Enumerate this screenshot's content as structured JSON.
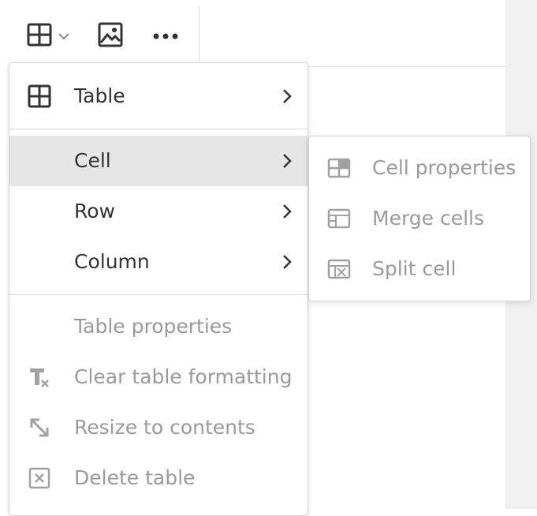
{
  "toolbar": {
    "table_icon": "table-icon",
    "table_dropdown_icon": "chevron-down-icon",
    "image_icon": "image-icon",
    "more_icon": "more-dots-icon"
  },
  "main_menu": {
    "table": {
      "label": "Table",
      "icon": "table-icon"
    },
    "cell": {
      "label": "Cell"
    },
    "row": {
      "label": "Row"
    },
    "column": {
      "label": "Column"
    },
    "table_properties": {
      "label": "Table properties"
    },
    "clear_formatting": {
      "label": "Clear table formatting",
      "icon": "clear-format-icon"
    },
    "resize": {
      "label": "Resize to contents",
      "icon": "resize-icon"
    },
    "delete": {
      "label": "Delete table",
      "icon": "delete-table-icon"
    }
  },
  "cell_submenu": {
    "cell_properties": {
      "label": "Cell properties",
      "icon": "cell-properties-icon"
    },
    "merge_cells": {
      "label": "Merge cells",
      "icon": "merge-cells-icon"
    },
    "split_cell": {
      "label": "Split cell",
      "icon": "split-cell-icon"
    }
  },
  "colors": {
    "text": "#333333",
    "disabled_text": "#9a9a9a",
    "hover_bg": "#e6e6e6",
    "border": "#d4d4d4"
  }
}
